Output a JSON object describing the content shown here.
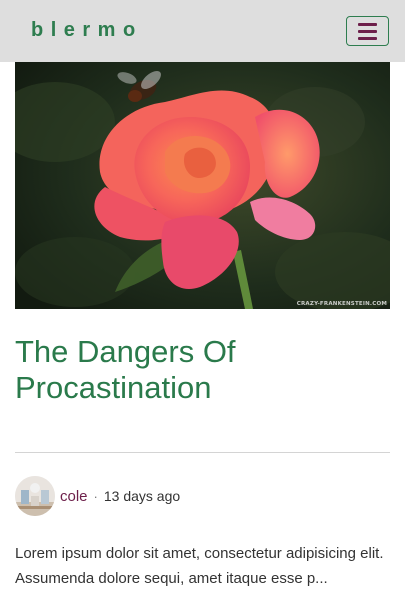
{
  "navbar": {
    "brand": "blermo",
    "menu_icon": "hamburger-menu-icon"
  },
  "hero": {
    "alt": "Pink rose with a bee",
    "watermark": "CRAZY-FRANKENSTEIN.COM"
  },
  "post": {
    "title": "The Dangers Of Procastination",
    "author": "cole",
    "separator": "·",
    "time": "13 days ago",
    "excerpt": "Lorem ipsum dolor sit amet, consectetur adipisicing elit. Assumenda dolore sequi, amet itaque esse p..."
  },
  "colors": {
    "brand": "#2e7d4f",
    "title": "#2a7a4b",
    "accent": "#6d1f4a",
    "navbar_bg": "#dedede"
  }
}
